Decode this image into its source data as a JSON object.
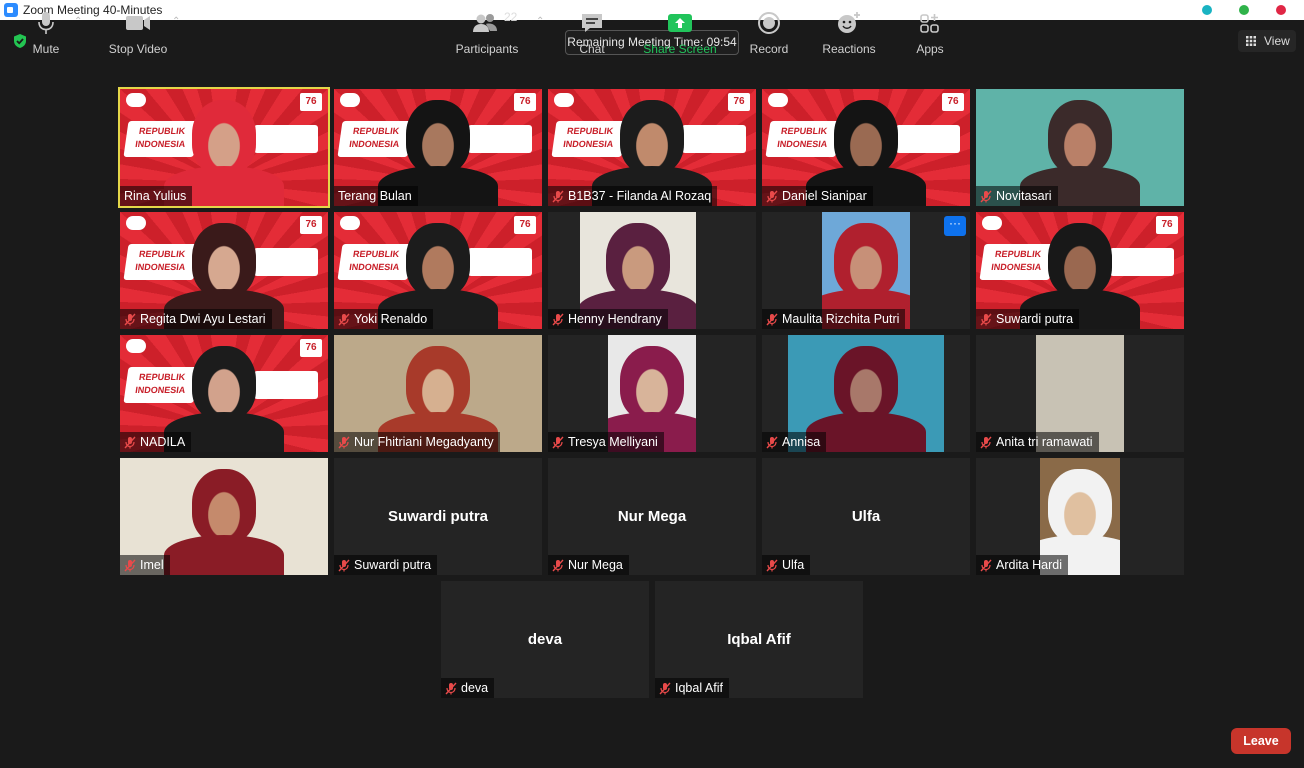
{
  "window": {
    "title": "Zoom Meeting 40-Minutes",
    "controls_colors": [
      "#19b3c2",
      "#2fb34a",
      "#e02645"
    ]
  },
  "timer": {
    "text": "Remaining Meeting Time: 09:54"
  },
  "view_button": {
    "label": "View"
  },
  "banner_text": {
    "republik": "REPUBLIK",
    "indonesia": "INDONESIA",
    "tag": "76"
  },
  "tiles": [
    {
      "name": "Rina Yulius",
      "muted": false,
      "active": true,
      "kind": "banner"
    },
    {
      "name": "Terang Bulan",
      "muted": false,
      "kind": "banner"
    },
    {
      "name": "B1B37 - Filanda Al Rozaq",
      "muted": true,
      "kind": "banner"
    },
    {
      "name": "Daniel Sianipar",
      "muted": true,
      "kind": "banner"
    },
    {
      "name": "Novitasari",
      "muted": true,
      "kind": "photo"
    },
    {
      "name": "Regita Dwi Ayu Lestari",
      "muted": true,
      "kind": "banner"
    },
    {
      "name": "Yoki Renaldo",
      "muted": true,
      "kind": "banner"
    },
    {
      "name": "Henny Hendrany",
      "muted": true,
      "kind": "photo"
    },
    {
      "name": "Maulita Rizchita Putri",
      "muted": true,
      "kind": "photo",
      "more": "···"
    },
    {
      "name": "Suwardi putra",
      "muted": true,
      "kind": "banner"
    },
    {
      "name": "NADILA",
      "muted": true,
      "kind": "banner"
    },
    {
      "name": "Nur Fhitriani Megadyanty",
      "muted": true,
      "kind": "photo"
    },
    {
      "name": "Tresya Melliyani",
      "muted": true,
      "kind": "photo"
    },
    {
      "name": "Annisa",
      "muted": true,
      "kind": "photo"
    },
    {
      "name": "Anita tri ramawati",
      "muted": true,
      "kind": "photo"
    },
    {
      "name": "Imel",
      "muted": true,
      "kind": "photo"
    },
    {
      "name": "Suwardi putra",
      "muted": true,
      "kind": "blank",
      "big": "Suwardi putra"
    },
    {
      "name": "Nur Mega",
      "muted": true,
      "kind": "blank",
      "big": "Nur Mega"
    },
    {
      "name": "Ulfa",
      "muted": true,
      "kind": "blank",
      "big": "Ulfa"
    },
    {
      "name": "Ardita Hardi",
      "muted": true,
      "kind": "photo"
    },
    {
      "name": "deva",
      "muted": true,
      "kind": "blank",
      "big": "deva"
    },
    {
      "name": "Iqbal Afif",
      "muted": true,
      "kind": "blank",
      "big": "Iqbal Afif"
    }
  ],
  "toolbar": {
    "mute": {
      "label": "Mute",
      "icon": "microphone-icon"
    },
    "stop_video": {
      "label": "Stop Video",
      "icon": "video-camera-icon"
    },
    "participants": {
      "label": "Participants",
      "count": "22",
      "icon": "participants-icon"
    },
    "chat": {
      "label": "Chat",
      "icon": "chat-bubble-icon"
    },
    "share_screen": {
      "label": "Share Screen",
      "icon": "share-arrow-icon",
      "color": "#21c45b"
    },
    "record": {
      "label": "Record",
      "icon": "record-icon"
    },
    "reactions": {
      "label": "Reactions",
      "icon": "smiley-plus-icon"
    },
    "apps": {
      "label": "Apps",
      "icon": "apps-icon"
    },
    "leave": {
      "label": "Leave",
      "color": "#c7352b"
    }
  }
}
